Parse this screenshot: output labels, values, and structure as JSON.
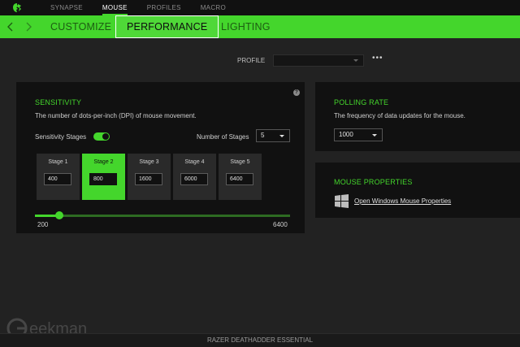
{
  "top_nav": {
    "items": [
      "SYNAPSE",
      "MOUSE",
      "PROFILES",
      "MACRO"
    ],
    "active": "MOUSE"
  },
  "sub_nav": {
    "tabs": [
      "CUSTOMIZE",
      "PERFORMANCE",
      "LIGHTING"
    ],
    "active": "PERFORMANCE"
  },
  "profile": {
    "label": "PROFILE",
    "value": "",
    "more_label": "•••"
  },
  "sensitivity": {
    "title": "SENSITIVITY",
    "description": "The number of dots-per-inch (DPI) of mouse movement.",
    "stages_toggle_label": "Sensitivity Stages",
    "stages_toggle_on": true,
    "number_of_stages_label": "Number of Stages",
    "number_of_stages_value": "5",
    "help_label": "?",
    "stages": [
      {
        "label": "Stage 1",
        "value": "400"
      },
      {
        "label": "Stage 2",
        "value": "800"
      },
      {
        "label": "Stage 3",
        "value": "1600"
      },
      {
        "label": "Stage 4",
        "value": "6000"
      },
      {
        "label": "Stage 5",
        "value": "6400"
      }
    ],
    "active_stage": 1,
    "slider": {
      "min": 200,
      "max": 6400,
      "value": 800,
      "min_label": "200",
      "max_label": "6400"
    }
  },
  "polling_rate": {
    "title": "POLLING RATE",
    "description": "The frequency of data updates for the mouse.",
    "value": "1000"
  },
  "mouse_properties": {
    "title": "MOUSE PROPERTIES",
    "link_label": "Open Windows Mouse Properties"
  },
  "footer": {
    "device_name": "RAZER DEATHADDER ESSENTIAL"
  },
  "watermark": {
    "text": "Geekman"
  },
  "colors": {
    "accent": "#44d62c",
    "background": "#222222",
    "panel": "#111111"
  }
}
